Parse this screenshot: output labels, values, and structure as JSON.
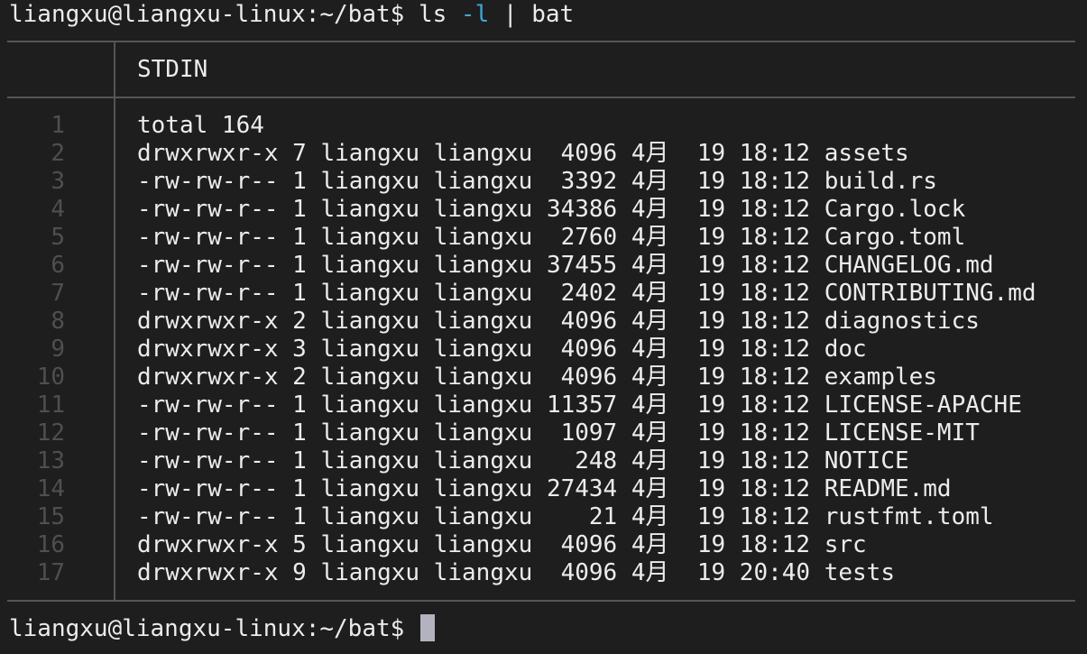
{
  "command": {
    "prompt": "liangxu@liangxu-linux:~/bat$",
    "cmd": "ls",
    "option": "-l",
    "rest": "| bat"
  },
  "header": {
    "file_name": "STDIN"
  },
  "lines": [
    {
      "number": "1",
      "text": "total 164"
    },
    {
      "number": "2",
      "text": "drwxrwxr-x 7 liangxu liangxu  4096 4月  19 18:12 assets"
    },
    {
      "number": "3",
      "text": "-rw-rw-r-- 1 liangxu liangxu  3392 4月  19 18:12 build.rs"
    },
    {
      "number": "4",
      "text": "-rw-rw-r-- 1 liangxu liangxu 34386 4月  19 18:12 Cargo.lock"
    },
    {
      "number": "5",
      "text": "-rw-rw-r-- 1 liangxu liangxu  2760 4月  19 18:12 Cargo.toml"
    },
    {
      "number": "6",
      "text": "-rw-rw-r-- 1 liangxu liangxu 37455 4月  19 18:12 CHANGELOG.md"
    },
    {
      "number": "7",
      "text": "-rw-rw-r-- 1 liangxu liangxu  2402 4月  19 18:12 CONTRIBUTING.md"
    },
    {
      "number": "8",
      "text": "drwxrwxr-x 2 liangxu liangxu  4096 4月  19 18:12 diagnostics"
    },
    {
      "number": "9",
      "text": "drwxrwxr-x 3 liangxu liangxu  4096 4月  19 18:12 doc"
    },
    {
      "number": "10",
      "text": "drwxrwxr-x 2 liangxu liangxu  4096 4月  19 18:12 examples"
    },
    {
      "number": "11",
      "text": "-rw-rw-r-- 1 liangxu liangxu 11357 4月  19 18:12 LICENSE-APACHE"
    },
    {
      "number": "12",
      "text": "-rw-rw-r-- 1 liangxu liangxu  1097 4月  19 18:12 LICENSE-MIT"
    },
    {
      "number": "13",
      "text": "-rw-rw-r-- 1 liangxu liangxu   248 4月  19 18:12 NOTICE"
    },
    {
      "number": "14",
      "text": "-rw-rw-r-- 1 liangxu liangxu 27434 4月  19 18:12 README.md"
    },
    {
      "number": "15",
      "text": "-rw-rw-r-- 1 liangxu liangxu    21 4月  19 18:12 rustfmt.toml"
    },
    {
      "number": "16",
      "text": "drwxrwxr-x 5 liangxu liangxu  4096 4月  19 18:12 src"
    },
    {
      "number": "17",
      "text": "drwxrwxr-x 9 liangxu liangxu  4096 4月  19 20:40 tests"
    }
  ],
  "next_prompt": {
    "prompt": "liangxu@liangxu-linux:~/bat$"
  },
  "colors": {
    "background": "#1e1e1e",
    "foreground": "#ececec",
    "option": "#3fa7d6",
    "line_number": "#4f4f4f",
    "grid": "#555555",
    "cursor": "#b3b3bf"
  }
}
